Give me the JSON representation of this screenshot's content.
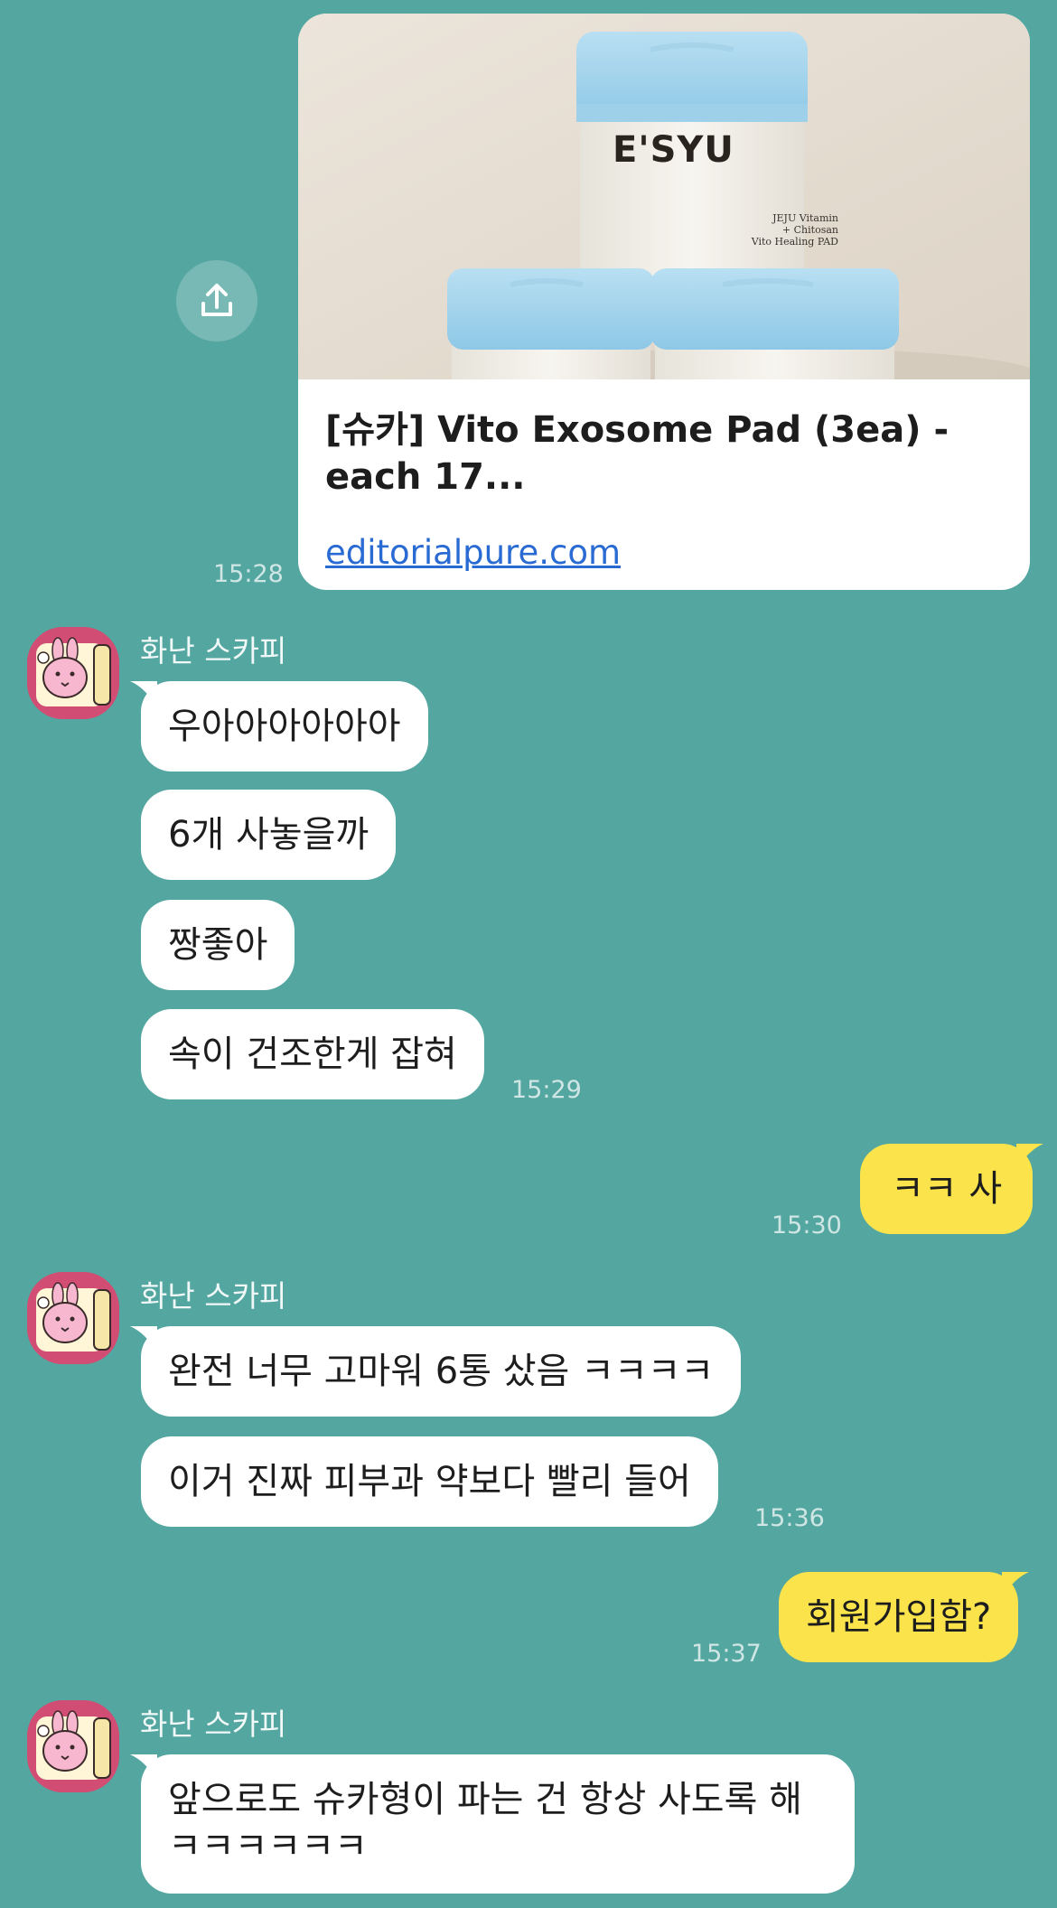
{
  "link_card": {
    "title": "[슈카] Vito Exosome Pad (3ea) - each 17...",
    "url": "editorialpure.com",
    "time": "15:28",
    "product_brand": "E'SYU",
    "product_text": [
      "JEJU Vitamin",
      "+ Chitosan",
      "Vito Healing PAD"
    ]
  },
  "groups": [
    {
      "sender": "화난 스카피",
      "messages": [
        "우아아아아아아",
        "6개 사놓을까",
        "짱좋아",
        "속이 건조한게 잡혀"
      ],
      "time": "15:29"
    },
    {
      "me": true,
      "messages": [
        "ㅋㅋ 사"
      ],
      "time": "15:30"
    },
    {
      "sender": "화난 스카피",
      "messages": [
        "완전 너무 고마워 6통 샀음 ㅋㅋㅋㅋ",
        "이거 진짜 피부과 약보다 빨리 들어"
      ],
      "time": "15:36"
    },
    {
      "me": true,
      "messages": [
        "회원가입함?"
      ],
      "time": "15:37"
    },
    {
      "sender": "화난 스카피",
      "messages": [
        "앞으로도 슈카형이 파는 건 항상 사도록 해",
        "ㅋㅋㅋㅋㅋㅋ"
      ]
    }
  ],
  "colors": {
    "background": "#54a6a0",
    "my_bubble": "#fbe44b",
    "their_bubble": "#ffffff",
    "link": "#2a6bd3"
  },
  "icons": {
    "share": "share-upload-icon",
    "avatar": "pink-rabbit-avatar"
  }
}
